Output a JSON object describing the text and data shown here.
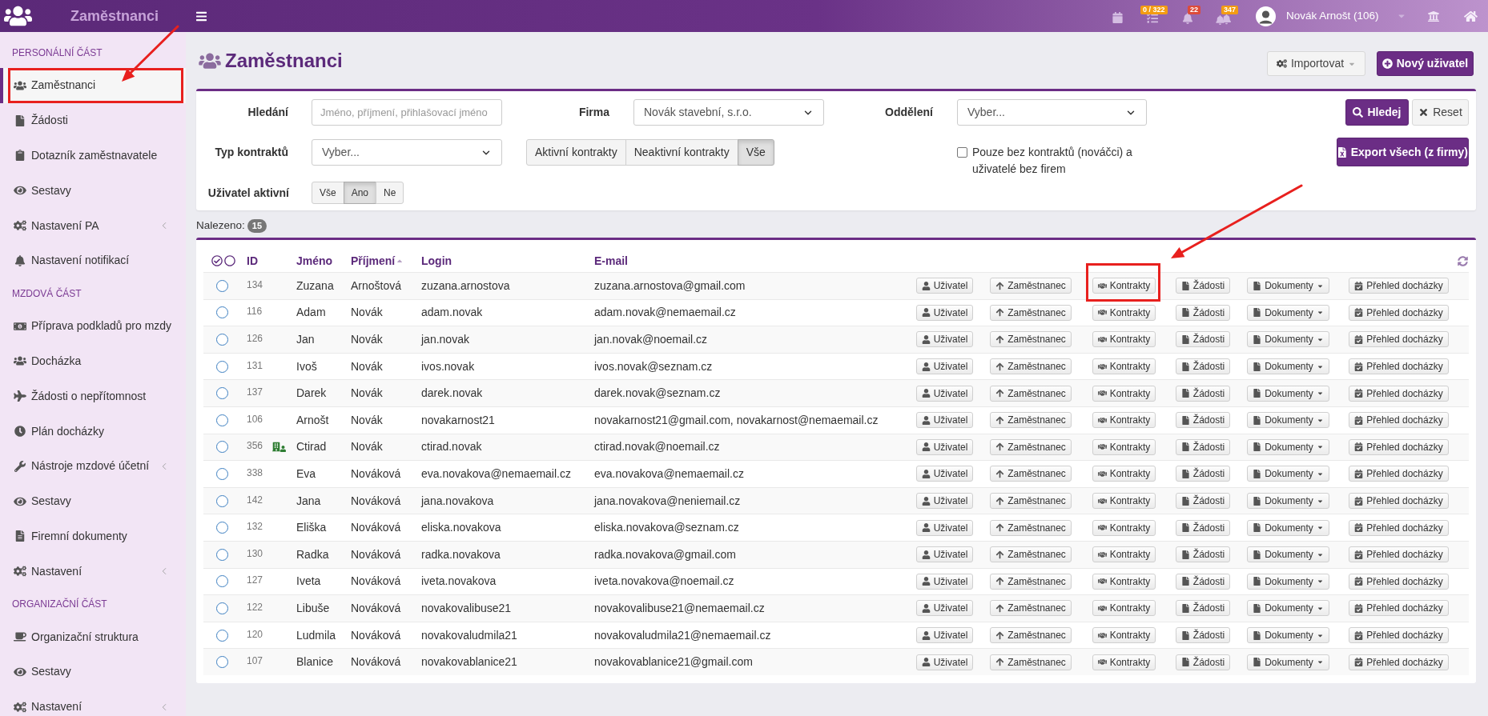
{
  "top_bar": {
    "app_title": "Zaměstnanci",
    "notifications": [
      {
        "badge": "0 / 322",
        "color": "#f39c12"
      },
      {
        "badge": "22",
        "color": "#dd4b39"
      },
      {
        "badge": "347",
        "color": "#f39c12"
      }
    ],
    "user_name": "Novák Arnošt (106)"
  },
  "sidebar": {
    "sections": [
      {
        "title": "PERSONÁLNÍ ČÁST",
        "items": [
          {
            "label": "Zaměstnanci",
            "selected": true,
            "highlighted": true
          },
          {
            "label": "Žádosti",
            "selected": false,
            "highlighted": false
          },
          {
            "label": "Dotazník zaměstnavatele",
            "selected": false,
            "highlighted": false
          },
          {
            "label": "Sestavy",
            "selected": false,
            "highlighted": false
          },
          {
            "label": "Nastavení PA",
            "selected": false,
            "highlighted": false,
            "expanded": false
          },
          {
            "label": "Nastavení notifikací",
            "selected": false,
            "highlighted": false
          }
        ]
      },
      {
        "title": "MZDOVÁ ČÁST",
        "items": [
          {
            "label": "Příprava podkladů pro mzdy",
            "selected": false,
            "highlighted": false
          },
          {
            "label": "Docházka",
            "selected": false,
            "highlighted": false
          },
          {
            "label": "Žádosti o nepřítomnost",
            "selected": false,
            "highlighted": false
          },
          {
            "label": "Plán docházky",
            "selected": false,
            "highlighted": false
          },
          {
            "label": "Nástroje mzdové účetní",
            "selected": false,
            "highlighted": false,
            "expanded": false
          },
          {
            "label": "Sestavy",
            "selected": false,
            "highlighted": false
          },
          {
            "label": "Firemní dokumenty",
            "selected": false,
            "highlighted": false
          },
          {
            "label": "Nastavení",
            "selected": false,
            "highlighted": false,
            "expanded": false
          }
        ]
      },
      {
        "title": "ORGANIZAČNÍ ČÁST",
        "items": [
          {
            "label": "Organizační struktura",
            "selected": false,
            "highlighted": false
          },
          {
            "label": "Sestavy",
            "selected": false,
            "highlighted": false
          },
          {
            "label": "Nastavení",
            "selected": false,
            "highlighted": false,
            "expanded": false
          }
        ]
      }
    ]
  },
  "page": {
    "title": "Zaměstnanci",
    "buttons": [
      {
        "label": "Importovat",
        "kind": "dropdown"
      },
      {
        "label": "Nový uživatel",
        "kind": "primary"
      }
    ]
  },
  "filters": {
    "search": {
      "label": "Hledání",
      "placeholder": "Jméno, příjmení, přihlašovací jméno"
    },
    "company": {
      "label": "Firma",
      "value": "Novák stavební, s.r.o."
    },
    "department": {
      "label": "Oddělení",
      "value": "Vyber..."
    },
    "search_buttons": [
      {
        "label": "Hledej",
        "kind": "primary"
      },
      {
        "label": "Reset",
        "kind": "secondary"
      }
    ],
    "contract_type": {
      "label": "Typ kontraktů",
      "value": "Vyber..."
    },
    "contract_state": [
      {
        "label": "Aktivní kontrakty",
        "selected": false
      },
      {
        "label": "Neaktivní kontrakty",
        "selected": false
      },
      {
        "label": "Vše",
        "selected": true
      }
    ],
    "no_contracts": {
      "label": "Pouze bez kontraktů (nováčci) a uživatelé bez firem",
      "checked": false
    },
    "export_button": {
      "label": "Export všech (z firmy)",
      "kind": "primary"
    },
    "user_active": {
      "label": "Uživatel aktivní",
      "options": [
        {
          "label": "Vše",
          "selected": false
        },
        {
          "label": "Ano",
          "selected": true
        },
        {
          "label": "Ne",
          "selected": false
        }
      ]
    }
  },
  "results": {
    "label": "Nalezeno:",
    "count": "15"
  },
  "table": {
    "columns": [
      {
        "label": "ID",
        "sorted": false
      },
      {
        "label": "Jméno",
        "sorted": false
      },
      {
        "label": "Příjmení",
        "sorted": true
      },
      {
        "label": "Login",
        "sorted": false
      },
      {
        "label": "E-mail",
        "sorted": false
      }
    ],
    "rows": [
      {
        "id": "134",
        "first_name": "Zuzana",
        "last_name": "Arnoštová",
        "login": "zuzana.arnostova",
        "email": "zuzana.arnostova@gmail.com",
        "selected": false,
        "marked": false,
        "actions": [
          {
            "label": "Uživatel",
            "kind": "button",
            "highlighted": false
          },
          {
            "label": "Zaměstnanec",
            "kind": "button",
            "highlighted": false
          },
          {
            "label": "Kontrakty",
            "kind": "button",
            "highlighted": true
          },
          {
            "label": "Žádosti",
            "kind": "button",
            "highlighted": false
          },
          {
            "label": "Dokumenty",
            "kind": "dropdown",
            "highlighted": false
          },
          {
            "label": "Přehled docházky",
            "kind": "button",
            "highlighted": false
          }
        ]
      },
      {
        "id": "116",
        "first_name": "Adam",
        "last_name": "Novák",
        "login": "adam.novak",
        "email": "adam.novak@nemaemail.cz",
        "selected": false,
        "marked": false,
        "actions": [
          {
            "label": "Uživatel",
            "kind": "button",
            "highlighted": false
          },
          {
            "label": "Zaměstnanec",
            "kind": "button",
            "highlighted": false
          },
          {
            "label": "Kontrakty",
            "kind": "button",
            "highlighted": false
          },
          {
            "label": "Žádosti",
            "kind": "button",
            "highlighted": false
          },
          {
            "label": "Dokumenty",
            "kind": "dropdown",
            "highlighted": false
          },
          {
            "label": "Přehled docházky",
            "kind": "button",
            "highlighted": false
          }
        ]
      },
      {
        "id": "126",
        "first_name": "Jan",
        "last_name": "Novák",
        "login": "jan.novak",
        "email": "jan.novak@noemail.cz",
        "selected": false,
        "marked": false,
        "actions": [
          {
            "label": "Uživatel",
            "kind": "button",
            "highlighted": false
          },
          {
            "label": "Zaměstnanec",
            "kind": "button",
            "highlighted": false
          },
          {
            "label": "Kontrakty",
            "kind": "button",
            "highlighted": false
          },
          {
            "label": "Žádosti",
            "kind": "button",
            "highlighted": false
          },
          {
            "label": "Dokumenty",
            "kind": "dropdown",
            "highlighted": false
          },
          {
            "label": "Přehled docházky",
            "kind": "button",
            "highlighted": false
          }
        ]
      },
      {
        "id": "131",
        "first_name": "Ivoš",
        "last_name": "Novák",
        "login": "ivos.novak",
        "email": "ivos.novak@seznam.cz",
        "selected": false,
        "marked": false,
        "actions": [
          {
            "label": "Uživatel",
            "kind": "button",
            "highlighted": false
          },
          {
            "label": "Zaměstnanec",
            "kind": "button",
            "highlighted": false
          },
          {
            "label": "Kontrakty",
            "kind": "button",
            "highlighted": false
          },
          {
            "label": "Žádosti",
            "kind": "button",
            "highlighted": false
          },
          {
            "label": "Dokumenty",
            "kind": "dropdown",
            "highlighted": false
          },
          {
            "label": "Přehled docházky",
            "kind": "button",
            "highlighted": false
          }
        ]
      },
      {
        "id": "137",
        "first_name": "Darek",
        "last_name": "Novák",
        "login": "darek.novak",
        "email": "darek.novak@seznam.cz",
        "selected": false,
        "marked": false,
        "actions": [
          {
            "label": "Uživatel",
            "kind": "button",
            "highlighted": false
          },
          {
            "label": "Zaměstnanec",
            "kind": "button",
            "highlighted": false
          },
          {
            "label": "Kontrakty",
            "kind": "button",
            "highlighted": false
          },
          {
            "label": "Žádosti",
            "kind": "button",
            "highlighted": false
          },
          {
            "label": "Dokumenty",
            "kind": "dropdown",
            "highlighted": false
          },
          {
            "label": "Přehled docházky",
            "kind": "button",
            "highlighted": false
          }
        ]
      },
      {
        "id": "106",
        "first_name": "Arnošt",
        "last_name": "Novák",
        "login": "novakarnost21",
        "email": "novakarnost21@gmail.com, novakarnost@nemaemail.cz",
        "selected": false,
        "marked": false,
        "actions": [
          {
            "label": "Uživatel",
            "kind": "button",
            "highlighted": false
          },
          {
            "label": "Zaměstnanec",
            "kind": "button",
            "highlighted": false
          },
          {
            "label": "Kontrakty",
            "kind": "button",
            "highlighted": false
          },
          {
            "label": "Žádosti",
            "kind": "button",
            "highlighted": false
          },
          {
            "label": "Dokumenty",
            "kind": "dropdown",
            "highlighted": false
          },
          {
            "label": "Přehled docházky",
            "kind": "button",
            "highlighted": false
          }
        ]
      },
      {
        "id": "356",
        "first_name": "Ctirad",
        "last_name": "Novák",
        "login": "ctirad.novak",
        "email": "ctirad.novak@noemail.cz",
        "selected": false,
        "marked": true,
        "actions": [
          {
            "label": "Uživatel",
            "kind": "button",
            "highlighted": false
          },
          {
            "label": "Zaměstnanec",
            "kind": "button",
            "highlighted": false
          },
          {
            "label": "Kontrakty",
            "kind": "button",
            "highlighted": false
          },
          {
            "label": "Žádosti",
            "kind": "button",
            "highlighted": false
          },
          {
            "label": "Dokumenty",
            "kind": "dropdown",
            "highlighted": false
          },
          {
            "label": "Přehled docházky",
            "kind": "button",
            "highlighted": false
          }
        ]
      },
      {
        "id": "338",
        "first_name": "Eva",
        "last_name": "Nováková",
        "login": "eva.novakova@nemaemail.cz",
        "email": "eva.novakova@nemaemail.cz",
        "selected": false,
        "marked": false,
        "actions": [
          {
            "label": "Uživatel",
            "kind": "button",
            "highlighted": false
          },
          {
            "label": "Zaměstnanec",
            "kind": "button",
            "highlighted": false
          },
          {
            "label": "Kontrakty",
            "kind": "button",
            "highlighted": false
          },
          {
            "label": "Žádosti",
            "kind": "button",
            "highlighted": false
          },
          {
            "label": "Dokumenty",
            "kind": "dropdown",
            "highlighted": false
          },
          {
            "label": "Přehled docházky",
            "kind": "button",
            "highlighted": false
          }
        ]
      },
      {
        "id": "142",
        "first_name": "Jana",
        "last_name": "Nováková",
        "login": "jana.novakova",
        "email": "jana.novakova@neniemail.cz",
        "selected": false,
        "marked": false,
        "actions": [
          {
            "label": "Uživatel",
            "kind": "button",
            "highlighted": false
          },
          {
            "label": "Zaměstnanec",
            "kind": "button",
            "highlighted": false
          },
          {
            "label": "Kontrakty",
            "kind": "button",
            "highlighted": false
          },
          {
            "label": "Žádosti",
            "kind": "button",
            "highlighted": false
          },
          {
            "label": "Dokumenty",
            "kind": "dropdown",
            "highlighted": false
          },
          {
            "label": "Přehled docházky",
            "kind": "button",
            "highlighted": false
          }
        ]
      },
      {
        "id": "132",
        "first_name": "Eliška",
        "last_name": "Nováková",
        "login": "eliska.novakova",
        "email": "eliska.novakova@seznam.cz",
        "selected": false,
        "marked": false,
        "actions": [
          {
            "label": "Uživatel",
            "kind": "button",
            "highlighted": false
          },
          {
            "label": "Zaměstnanec",
            "kind": "button",
            "highlighted": false
          },
          {
            "label": "Kontrakty",
            "kind": "button",
            "highlighted": false
          },
          {
            "label": "Žádosti",
            "kind": "button",
            "highlighted": false
          },
          {
            "label": "Dokumenty",
            "kind": "dropdown",
            "highlighted": false
          },
          {
            "label": "Přehled docházky",
            "kind": "button",
            "highlighted": false
          }
        ]
      },
      {
        "id": "130",
        "first_name": "Radka",
        "last_name": "Nováková",
        "login": "radka.novakova",
        "email": "radka.novakova@gmail.com",
        "selected": false,
        "marked": false,
        "actions": [
          {
            "label": "Uživatel",
            "kind": "button",
            "highlighted": false
          },
          {
            "label": "Zaměstnanec",
            "kind": "button",
            "highlighted": false
          },
          {
            "label": "Kontrakty",
            "kind": "button",
            "highlighted": false
          },
          {
            "label": "Žádosti",
            "kind": "button",
            "highlighted": false
          },
          {
            "label": "Dokumenty",
            "kind": "dropdown",
            "highlighted": false
          },
          {
            "label": "Přehled docházky",
            "kind": "button",
            "highlighted": false
          }
        ]
      },
      {
        "id": "127",
        "first_name": "Iveta",
        "last_name": "Nováková",
        "login": "iveta.novakova",
        "email": "iveta.novakova@noemail.cz",
        "selected": false,
        "marked": false,
        "actions": [
          {
            "label": "Uživatel",
            "kind": "button",
            "highlighted": false
          },
          {
            "label": "Zaměstnanec",
            "kind": "button",
            "highlighted": false
          },
          {
            "label": "Kontrakty",
            "kind": "button",
            "highlighted": false
          },
          {
            "label": "Žádosti",
            "kind": "button",
            "highlighted": false
          },
          {
            "label": "Dokumenty",
            "kind": "dropdown",
            "highlighted": false
          },
          {
            "label": "Přehled docházky",
            "kind": "button",
            "highlighted": false
          }
        ]
      },
      {
        "id": "122",
        "first_name": "Libuše",
        "last_name": "Nováková",
        "login": "novakovalibuse21",
        "email": "novakovalibuse21@nemaemail.cz",
        "selected": false,
        "marked": false,
        "actions": [
          {
            "label": "Uživatel",
            "kind": "button",
            "highlighted": false
          },
          {
            "label": "Zaměstnanec",
            "kind": "button",
            "highlighted": false
          },
          {
            "label": "Kontrakty",
            "kind": "button",
            "highlighted": false
          },
          {
            "label": "Žádosti",
            "kind": "button",
            "highlighted": false
          },
          {
            "label": "Dokumenty",
            "kind": "dropdown",
            "highlighted": false
          },
          {
            "label": "Přehled docházky",
            "kind": "button",
            "highlighted": false
          }
        ]
      },
      {
        "id": "120",
        "first_name": "Ludmila",
        "last_name": "Nováková",
        "login": "novakovaludmila21",
        "email": "novakovaludmila21@nemaemail.cz",
        "selected": false,
        "marked": false,
        "actions": [
          {
            "label": "Uživatel",
            "kind": "button",
            "highlighted": false
          },
          {
            "label": "Zaměstnanec",
            "kind": "button",
            "highlighted": false
          },
          {
            "label": "Kontrakty",
            "kind": "button",
            "highlighted": false
          },
          {
            "label": "Žádosti",
            "kind": "button",
            "highlighted": false
          },
          {
            "label": "Dokumenty",
            "kind": "dropdown",
            "highlighted": false
          },
          {
            "label": "Přehled docházky",
            "kind": "button",
            "highlighted": false
          }
        ]
      },
      {
        "id": "107",
        "first_name": "Blanice",
        "last_name": "Nováková",
        "login": "novakovablanice21",
        "email": "novakovablanice21@gmail.com",
        "selected": false,
        "marked": false,
        "actions": [
          {
            "label": "Uživatel",
            "kind": "button",
            "highlighted": false
          },
          {
            "label": "Zaměstnanec",
            "kind": "button",
            "highlighted": false
          },
          {
            "label": "Kontrakty",
            "kind": "button",
            "highlighted": false
          },
          {
            "label": "Žádosti",
            "kind": "button",
            "highlighted": false
          },
          {
            "label": "Dokumenty",
            "kind": "dropdown",
            "highlighted": false
          },
          {
            "label": "Přehled docházky",
            "kind": "button",
            "highlighted": false
          }
        ]
      }
    ]
  }
}
